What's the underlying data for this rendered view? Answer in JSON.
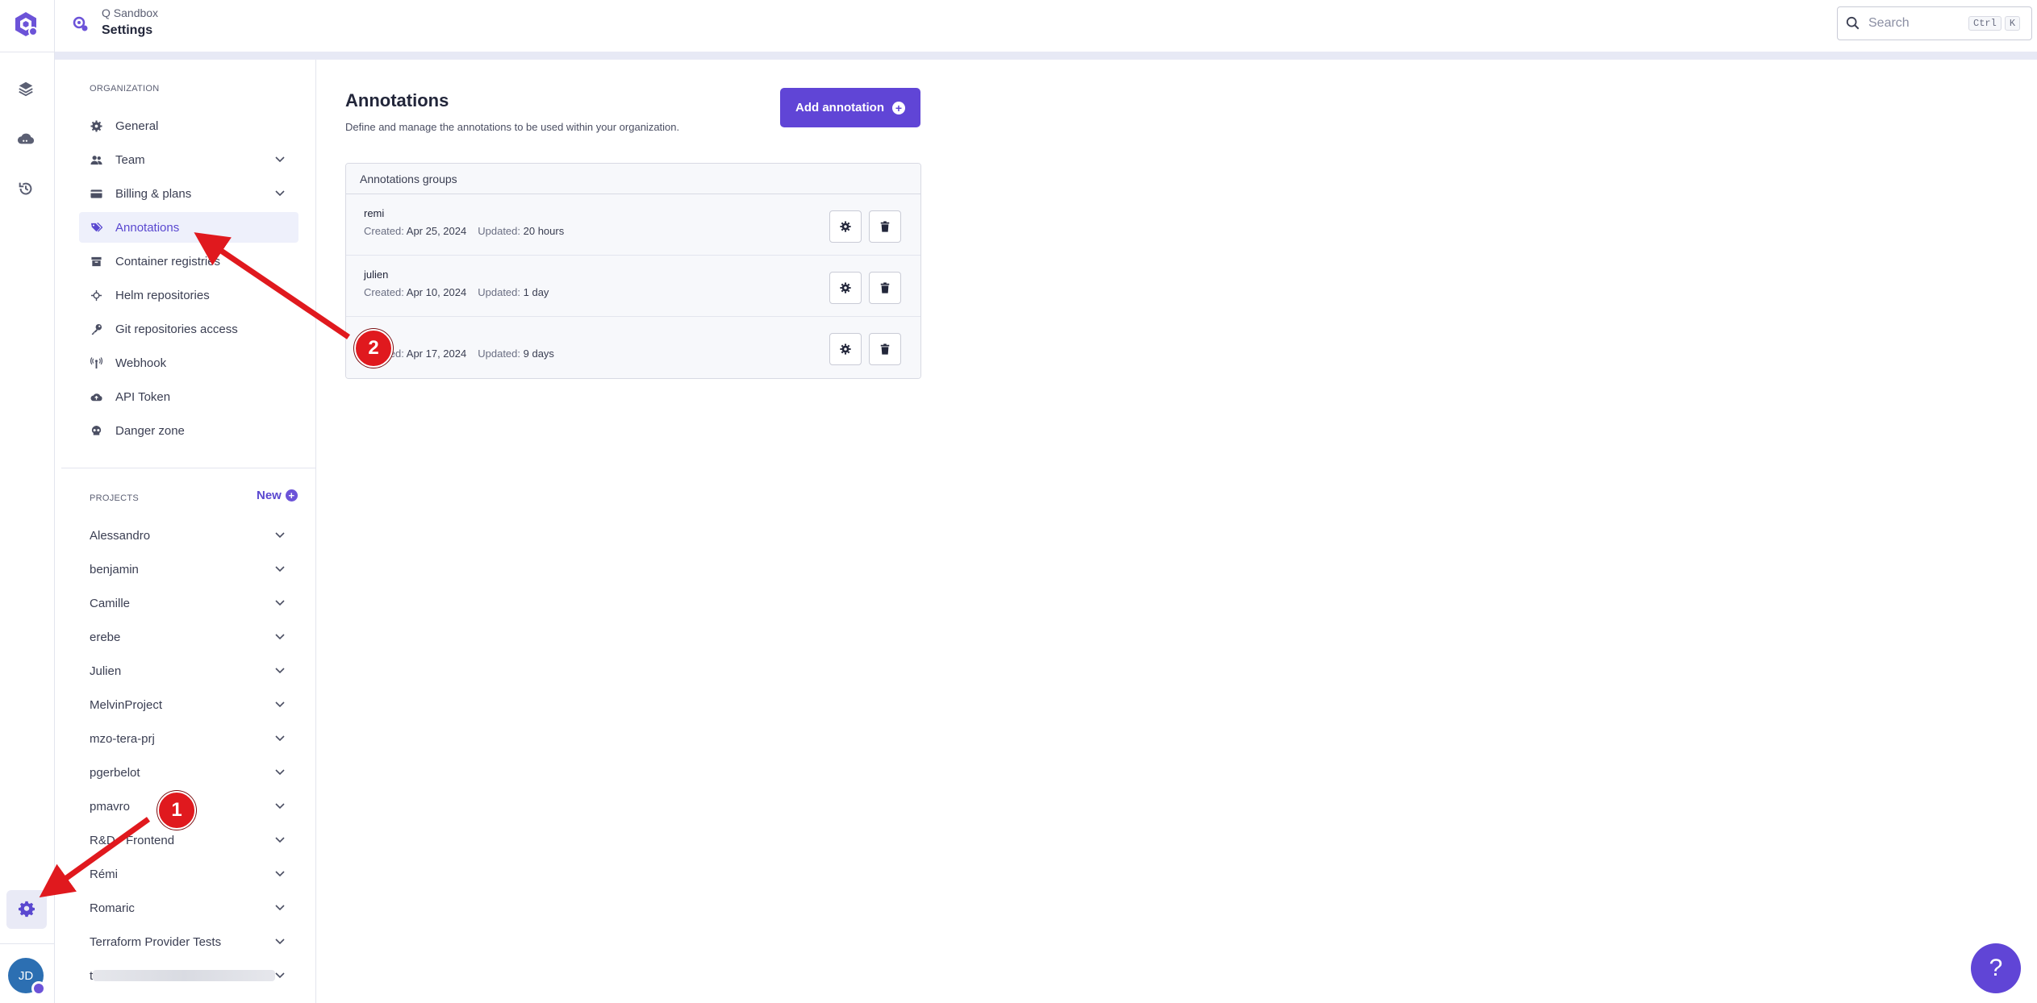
{
  "header": {
    "org_name": "Q Sandbox",
    "page_name": "Settings",
    "search_placeholder": "Search",
    "shortcut_key1": "Ctrl",
    "shortcut_key2": "K"
  },
  "rail": {
    "items": [
      "layers-icon",
      "cloud-icon",
      "history-icon"
    ],
    "settings_icon": "gear-icon",
    "avatar_initials": "JD"
  },
  "sidebar": {
    "organization_label": "ORGANIZATION",
    "items": [
      {
        "label": "General",
        "icon": "gear-icon",
        "expandable": false
      },
      {
        "label": "Team",
        "icon": "users-icon",
        "expandable": true
      },
      {
        "label": "Billing & plans",
        "icon": "credit-card-icon",
        "expandable": true
      },
      {
        "label": "Annotations",
        "icon": "tags-icon",
        "expandable": false,
        "active": true
      },
      {
        "label": "Container registries",
        "icon": "box-icon",
        "expandable": false
      },
      {
        "label": "Helm repositories",
        "icon": "helm-icon",
        "expandable": false
      },
      {
        "label": "Git repositories access",
        "icon": "key-icon",
        "expandable": false
      },
      {
        "label": "Webhook",
        "icon": "antenna-icon",
        "expandable": false
      },
      {
        "label": "API Token",
        "icon": "cloud-upload-icon",
        "expandable": false
      },
      {
        "label": "Danger zone",
        "icon": "skull-icon",
        "expandable": false
      }
    ],
    "projects_label": "PROJECTS",
    "new_label": "New",
    "projects": [
      "Alessandro",
      "benjamin",
      "Camille",
      "erebe",
      "Julien",
      "MelvinProject",
      "mzo-tera-prj",
      "pgerbelot",
      "pmavro",
      "R&D - Frontend",
      "Rémi",
      "Romaric",
      "Terraform Provider Tests",
      "t"
    ]
  },
  "main": {
    "title": "Annotations",
    "description": "Define and manage the annotations to be used within your organization.",
    "add_button": "Add annotation",
    "panel_title": "Annotations groups",
    "created_label": "Created:",
    "updated_label": "Updated:",
    "groups": [
      {
        "name": "remi",
        "created": "Apr 25, 2024",
        "updated": "20 hours"
      },
      {
        "name": "julien",
        "created": "Apr 10, 2024",
        "updated": "1 day"
      },
      {
        "name": "",
        "created": "Apr 17, 2024",
        "updated": "9 days"
      }
    ]
  },
  "annotations": {
    "marker1": "1",
    "marker2": "2",
    "arrow_color": "#e0191e"
  },
  "help": {
    "label": "?"
  },
  "colors": {
    "accent": "#6045d6",
    "active_bg": "#eef0fb"
  }
}
